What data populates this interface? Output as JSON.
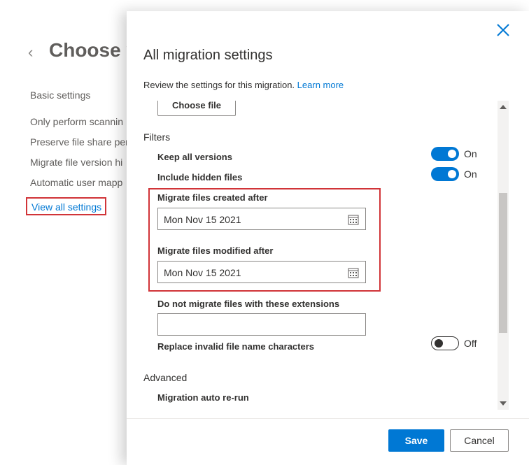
{
  "background": {
    "title": "Choose y",
    "section": "Basic settings",
    "items": [
      "Only perform scannin",
      "Preserve file share per",
      "Migrate file version hi",
      "Automatic user mapp"
    ],
    "view_all_link": "View all settings"
  },
  "panel": {
    "title": "All migration settings",
    "description": "Review the settings for this migration.",
    "learn_more": "Learn more",
    "choose_file_label": "Choose file",
    "filters_section": "Filters",
    "keep_versions_label": "Keep all versions",
    "keep_versions_state": "On",
    "hidden_files_label": "Include hidden files",
    "hidden_files_state": "On",
    "created_after_label": "Migrate files created after",
    "created_after_value": "Mon Nov 15 2021",
    "modified_after_label": "Migrate files modified after",
    "modified_after_value": "Mon Nov 15 2021",
    "extensions_label": "Do not migrate files with these extensions",
    "extensions_value": "",
    "replace_invalid_label": "Replace invalid file name characters",
    "replace_invalid_state": "Off",
    "advanced_section": "Advanced",
    "auto_rerun_label": "Migration auto re-run"
  },
  "footer": {
    "save_label": "Save",
    "cancel_label": "Cancel"
  },
  "colors": {
    "accent": "#0078d4",
    "highlight": "#d13438"
  }
}
